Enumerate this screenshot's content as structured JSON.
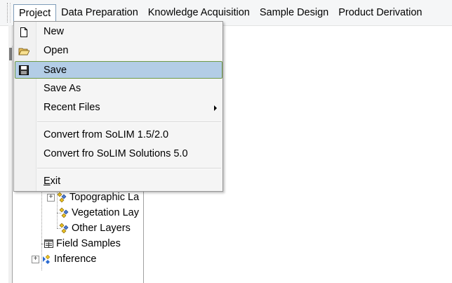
{
  "menubar": {
    "items": [
      {
        "label": "Project"
      },
      {
        "label": "Data Preparation"
      },
      {
        "label": "Knowledge Acquisition"
      },
      {
        "label": "Sample Design"
      },
      {
        "label": "Product Derivation"
      }
    ]
  },
  "project_menu": {
    "items": [
      {
        "label": "New",
        "icon": "new-file-icon"
      },
      {
        "label": "Open",
        "icon": "open-folder-icon"
      },
      {
        "label": "Save",
        "icon": "save-disk-icon",
        "highlighted": true
      },
      {
        "label": "Save As"
      },
      {
        "label": "Recent Files",
        "submenu": true
      },
      {
        "label": "Convert from SoLIM 1.5/2.0"
      },
      {
        "label": "Convert fro SoLIM Solutions 5.0"
      },
      {
        "label": "Exit"
      }
    ]
  },
  "tree": {
    "nodes": [
      {
        "label": "Topographic La",
        "icon": "layer-group-icon"
      },
      {
        "label": "Vegetation Lay",
        "icon": "layer-group-icon"
      },
      {
        "label": "Other Layers",
        "icon": "layer-group-icon"
      },
      {
        "label": "Field Samples",
        "icon": "field-samples-icon"
      },
      {
        "label": "Inference",
        "icon": "inference-icon"
      }
    ]
  },
  "colors": {
    "menu_highlight": "#b3cde6",
    "highlight_border": "#6f9a47"
  }
}
